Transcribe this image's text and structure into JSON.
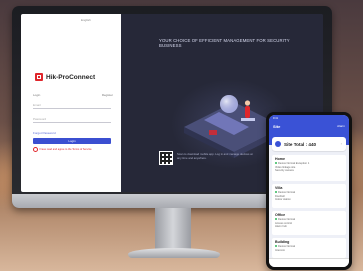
{
  "login": {
    "language": "English",
    "brand": "Hik-ProConnect",
    "label_left": "Login",
    "label_right": "Register",
    "username_placeholder": "Email",
    "password_placeholder": "Password",
    "forgot": "Forgot Password",
    "login_button": "Login",
    "agreement": "I have read and agree to the Terms of Service"
  },
  "art": {
    "slogan": "YOUR CHOICE OF EFFICIENT MANAGEMENT FOR SECURITY BUSINESS",
    "qr_caption": "Scan to download mobile app. Log in and manage devices at any time and anywhere."
  },
  "phone": {
    "status": "9:41",
    "header": "Site",
    "badge": "Alarm",
    "site_title": "Site Total : 440",
    "groups": [
      {
        "title": "Home",
        "lines": [
          "Device Normal   Exception 1",
          "Video linkage site",
          "Security camera"
        ]
      },
      {
        "title": "Villa",
        "lines": [
          "Device Normal",
          "Doorbell",
          "Indoor station"
        ]
      },
      {
        "title": "Office",
        "lines": [
          "Device Normal",
          "Access control",
          "Alarm hub"
        ]
      },
      {
        "title": "Building",
        "lines": [
          "Device Normal",
          "Intercom"
        ]
      }
    ],
    "colors": {
      "accent": "#3a52d6",
      "exception": "#e0262b",
      "ok": "#2fb85a"
    }
  }
}
